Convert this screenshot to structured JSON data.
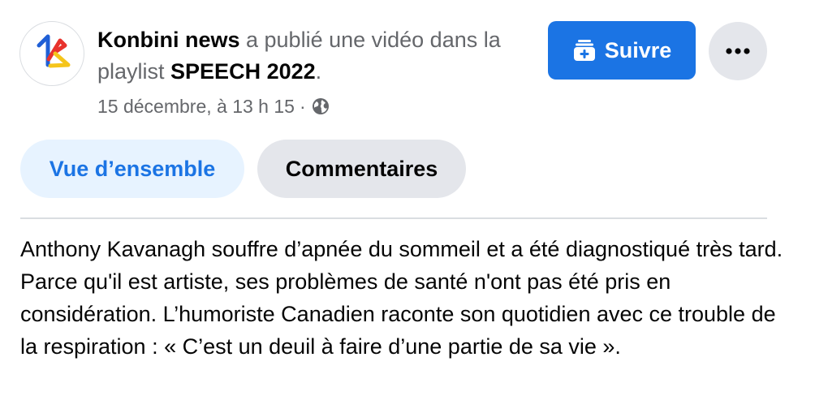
{
  "post": {
    "page_name": "Konbini news",
    "action_text_1": " a publié une vidéo dans la playlist ",
    "playlist_name": "SPEECH 2022",
    "action_text_2": ".",
    "timestamp": "15 décembre, à 13 h 15",
    "separator": "·",
    "privacy_icon": "globe-icon",
    "avatar_icon": "konbini-logo"
  },
  "actions": {
    "follow_label": "Suivre",
    "follow_icon": "add-to-playlist-icon",
    "more_icon": "more-horizontal-icon"
  },
  "tabs": [
    {
      "label": "Vue d’ensemble",
      "active": true
    },
    {
      "label": "Commentaires",
      "active": false
    }
  ],
  "description": "Anthony Kavanagh souffre d’apnée du sommeil et a été diagnostiqué très tard. Parce qu'il est artiste, ses problèmes de santé n'ont pas été pris en considération. L’humoriste Canadien raconte son quotidien avec ce trouble de la respiration : « C’est un deuil à faire d’une partie de sa vie ».",
  "colors": {
    "accent": "#1b74e4",
    "tab_active_bg": "#e7f3ff",
    "neutral_button_bg": "#e4e6eb",
    "secondary_text": "#65676b",
    "logo_blue": "#1f5fd6",
    "logo_red": "#e8322d",
    "logo_yellow": "#f5c51b"
  }
}
